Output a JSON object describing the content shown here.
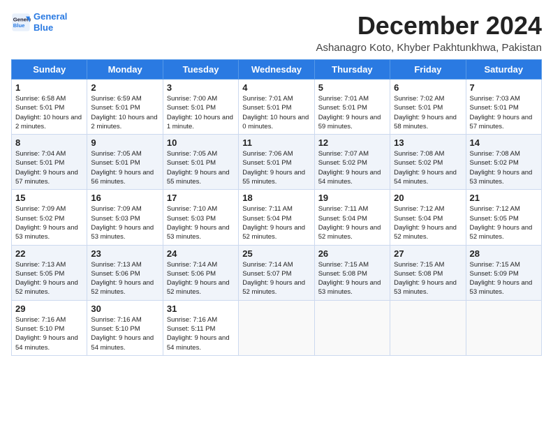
{
  "header": {
    "logo_line1": "General",
    "logo_line2": "Blue",
    "title": "December 2024",
    "subtitle": "Ashanagro Koto, Khyber Pakhtunkhwa, Pakistan"
  },
  "days_of_week": [
    "Sunday",
    "Monday",
    "Tuesday",
    "Wednesday",
    "Thursday",
    "Friday",
    "Saturday"
  ],
  "weeks": [
    [
      {
        "day": "1",
        "sunrise": "6:58 AM",
        "sunset": "5:01 PM",
        "daylight": "10 hours and 2 minutes."
      },
      {
        "day": "2",
        "sunrise": "6:59 AM",
        "sunset": "5:01 PM",
        "daylight": "10 hours and 2 minutes."
      },
      {
        "day": "3",
        "sunrise": "7:00 AM",
        "sunset": "5:01 PM",
        "daylight": "10 hours and 1 minute."
      },
      {
        "day": "4",
        "sunrise": "7:01 AM",
        "sunset": "5:01 PM",
        "daylight": "10 hours and 0 minutes."
      },
      {
        "day": "5",
        "sunrise": "7:01 AM",
        "sunset": "5:01 PM",
        "daylight": "9 hours and 59 minutes."
      },
      {
        "day": "6",
        "sunrise": "7:02 AM",
        "sunset": "5:01 PM",
        "daylight": "9 hours and 58 minutes."
      },
      {
        "day": "7",
        "sunrise": "7:03 AM",
        "sunset": "5:01 PM",
        "daylight": "9 hours and 57 minutes."
      }
    ],
    [
      {
        "day": "8",
        "sunrise": "7:04 AM",
        "sunset": "5:01 PM",
        "daylight": "9 hours and 57 minutes."
      },
      {
        "day": "9",
        "sunrise": "7:05 AM",
        "sunset": "5:01 PM",
        "daylight": "9 hours and 56 minutes."
      },
      {
        "day": "10",
        "sunrise": "7:05 AM",
        "sunset": "5:01 PM",
        "daylight": "9 hours and 55 minutes."
      },
      {
        "day": "11",
        "sunrise": "7:06 AM",
        "sunset": "5:01 PM",
        "daylight": "9 hours and 55 minutes."
      },
      {
        "day": "12",
        "sunrise": "7:07 AM",
        "sunset": "5:02 PM",
        "daylight": "9 hours and 54 minutes."
      },
      {
        "day": "13",
        "sunrise": "7:08 AM",
        "sunset": "5:02 PM",
        "daylight": "9 hours and 54 minutes."
      },
      {
        "day": "14",
        "sunrise": "7:08 AM",
        "sunset": "5:02 PM",
        "daylight": "9 hours and 53 minutes."
      }
    ],
    [
      {
        "day": "15",
        "sunrise": "7:09 AM",
        "sunset": "5:02 PM",
        "daylight": "9 hours and 53 minutes."
      },
      {
        "day": "16",
        "sunrise": "7:09 AM",
        "sunset": "5:03 PM",
        "daylight": "9 hours and 53 minutes."
      },
      {
        "day": "17",
        "sunrise": "7:10 AM",
        "sunset": "5:03 PM",
        "daylight": "9 hours and 53 minutes."
      },
      {
        "day": "18",
        "sunrise": "7:11 AM",
        "sunset": "5:04 PM",
        "daylight": "9 hours and 52 minutes."
      },
      {
        "day": "19",
        "sunrise": "7:11 AM",
        "sunset": "5:04 PM",
        "daylight": "9 hours and 52 minutes."
      },
      {
        "day": "20",
        "sunrise": "7:12 AM",
        "sunset": "5:04 PM",
        "daylight": "9 hours and 52 minutes."
      },
      {
        "day": "21",
        "sunrise": "7:12 AM",
        "sunset": "5:05 PM",
        "daylight": "9 hours and 52 minutes."
      }
    ],
    [
      {
        "day": "22",
        "sunrise": "7:13 AM",
        "sunset": "5:05 PM",
        "daylight": "9 hours and 52 minutes."
      },
      {
        "day": "23",
        "sunrise": "7:13 AM",
        "sunset": "5:06 PM",
        "daylight": "9 hours and 52 minutes."
      },
      {
        "day": "24",
        "sunrise": "7:14 AM",
        "sunset": "5:06 PM",
        "daylight": "9 hours and 52 minutes."
      },
      {
        "day": "25",
        "sunrise": "7:14 AM",
        "sunset": "5:07 PM",
        "daylight": "9 hours and 52 minutes."
      },
      {
        "day": "26",
        "sunrise": "7:15 AM",
        "sunset": "5:08 PM",
        "daylight": "9 hours and 53 minutes."
      },
      {
        "day": "27",
        "sunrise": "7:15 AM",
        "sunset": "5:08 PM",
        "daylight": "9 hours and 53 minutes."
      },
      {
        "day": "28",
        "sunrise": "7:15 AM",
        "sunset": "5:09 PM",
        "daylight": "9 hours and 53 minutes."
      }
    ],
    [
      {
        "day": "29",
        "sunrise": "7:16 AM",
        "sunset": "5:10 PM",
        "daylight": "9 hours and 54 minutes."
      },
      {
        "day": "30",
        "sunrise": "7:16 AM",
        "sunset": "5:10 PM",
        "daylight": "9 hours and 54 minutes."
      },
      {
        "day": "31",
        "sunrise": "7:16 AM",
        "sunset": "5:11 PM",
        "daylight": "9 hours and 54 minutes."
      },
      null,
      null,
      null,
      null
    ]
  ]
}
